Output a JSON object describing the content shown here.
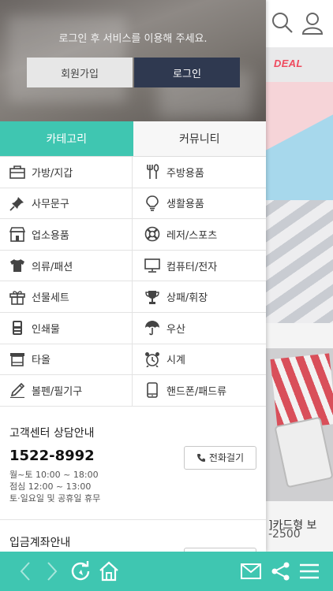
{
  "drawer": {
    "login_message": "로그인 후 서비스를 이용해 주세요.",
    "join_label": "회원가입",
    "login_label": "로그인",
    "tabs": [
      {
        "label": "카테고리",
        "active": true
      },
      {
        "label": "커뮤니티",
        "active": false
      }
    ],
    "categories": [
      {
        "label": "가방/지갑",
        "icon": "bag-icon"
      },
      {
        "label": "주방용품",
        "icon": "kitchen-utensils-icon"
      },
      {
        "label": "사무문구",
        "icon": "pushpin-icon"
      },
      {
        "label": "생활용품",
        "icon": "lightbulb-icon"
      },
      {
        "label": "업소용품",
        "icon": "store-icon"
      },
      {
        "label": "레저/스포츠",
        "icon": "lifebuoy-icon"
      },
      {
        "label": "의류/패션",
        "icon": "shirt-icon"
      },
      {
        "label": "컴퓨터/전자",
        "icon": "monitor-icon"
      },
      {
        "label": "선물세트",
        "icon": "gift-icon"
      },
      {
        "label": "상패/휘장",
        "icon": "trophy-icon"
      },
      {
        "label": "인쇄물",
        "icon": "printer-icon"
      },
      {
        "label": "우산",
        "icon": "umbrella-icon"
      },
      {
        "label": "타올",
        "icon": "towel-icon"
      },
      {
        "label": "시계",
        "icon": "alarm-clock-icon"
      },
      {
        "label": "볼펜/필기구",
        "icon": "pen-icon"
      },
      {
        "label": "핸드폰/패드류",
        "icon": "phone-icon"
      }
    ],
    "customer_service": {
      "title": "고객센터 상담안내",
      "phone": "1522-8992",
      "hours": [
        "월~토 10:00 ~ 18:00",
        "점심 12:00 ~ 13:00",
        "토·일요일 및 공휴일 휴무"
      ],
      "call_label": "전화걸기"
    },
    "deposit": {
      "title": "입금계좌안내"
    }
  },
  "background": {
    "logo_text": "DEAL",
    "product_text": "]카드형 보",
    "product_price": "-2500"
  },
  "colors": {
    "accent": "#3fc6b1",
    "login_button": "#2f3950",
    "join_button": "#e7e7e7"
  },
  "bottom_bar_icons": [
    "back-arrow-icon",
    "forward-arrow-icon",
    "refresh-icon",
    "home-icon",
    "mail-icon",
    "share-icon",
    "menu-icon"
  ]
}
